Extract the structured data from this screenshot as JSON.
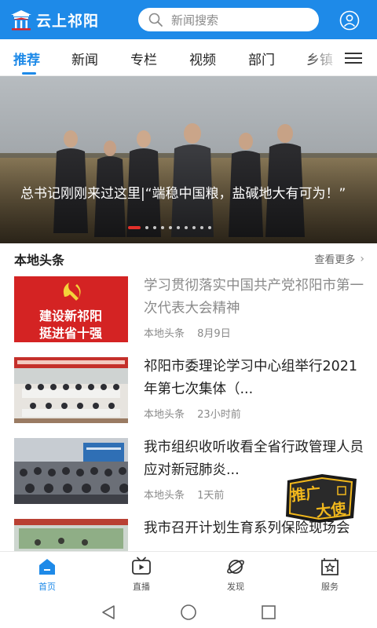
{
  "app": {
    "name": "云上祁阳",
    "brand_color": "#1e8ae8"
  },
  "search": {
    "placeholder": "新闻搜索"
  },
  "tabs": [
    {
      "label": "推荐",
      "active": true
    },
    {
      "label": "新闻"
    },
    {
      "label": "专栏"
    },
    {
      "label": "视频"
    },
    {
      "label": "部门"
    },
    {
      "label": "乡镇"
    }
  ],
  "banner": {
    "title": "总书记刚刚来过这里|“端稳中国粮，盐碱地大有可为！”",
    "slide_count": 10,
    "active_slide": 1
  },
  "section": {
    "title": "本地头条",
    "more_label": "查看更多"
  },
  "news": [
    {
      "title": "学习贯彻落实中国共产党祁阳市第一次代表大会精神",
      "source": "本地头条",
      "time": "8月9日",
      "read": true,
      "thumb_text": [
        "建设新祁阳",
        "挺进省十强"
      ]
    },
    {
      "title": "祁阳市委理论学习中心组举行2021年第七次集体（...",
      "source": "本地头条",
      "time": "23小时前",
      "read": false
    },
    {
      "title": "我市组织收听收看全省行政管理人员应对新冠肺炎...",
      "source": "本地头条",
      "time": "1天前",
      "read": false
    },
    {
      "title": "我市召开计划生育系列保险现场会",
      "read": false
    }
  ],
  "float_badge": {
    "label_line1": "推广",
    "label_line2": "大使",
    "icon": "promo-ambassador-badge"
  },
  "bottom_nav": [
    {
      "label": "首页",
      "icon": "home-icon",
      "active": true
    },
    {
      "label": "直播",
      "icon": "tv-icon"
    },
    {
      "label": "发现",
      "icon": "planet-icon"
    },
    {
      "label": "服务",
      "icon": "star-box-icon"
    }
  ],
  "system_nav": {
    "back_icon": "back-triangle-icon",
    "home_icon": "home-circle-icon",
    "recents_icon": "recents-square-icon"
  }
}
